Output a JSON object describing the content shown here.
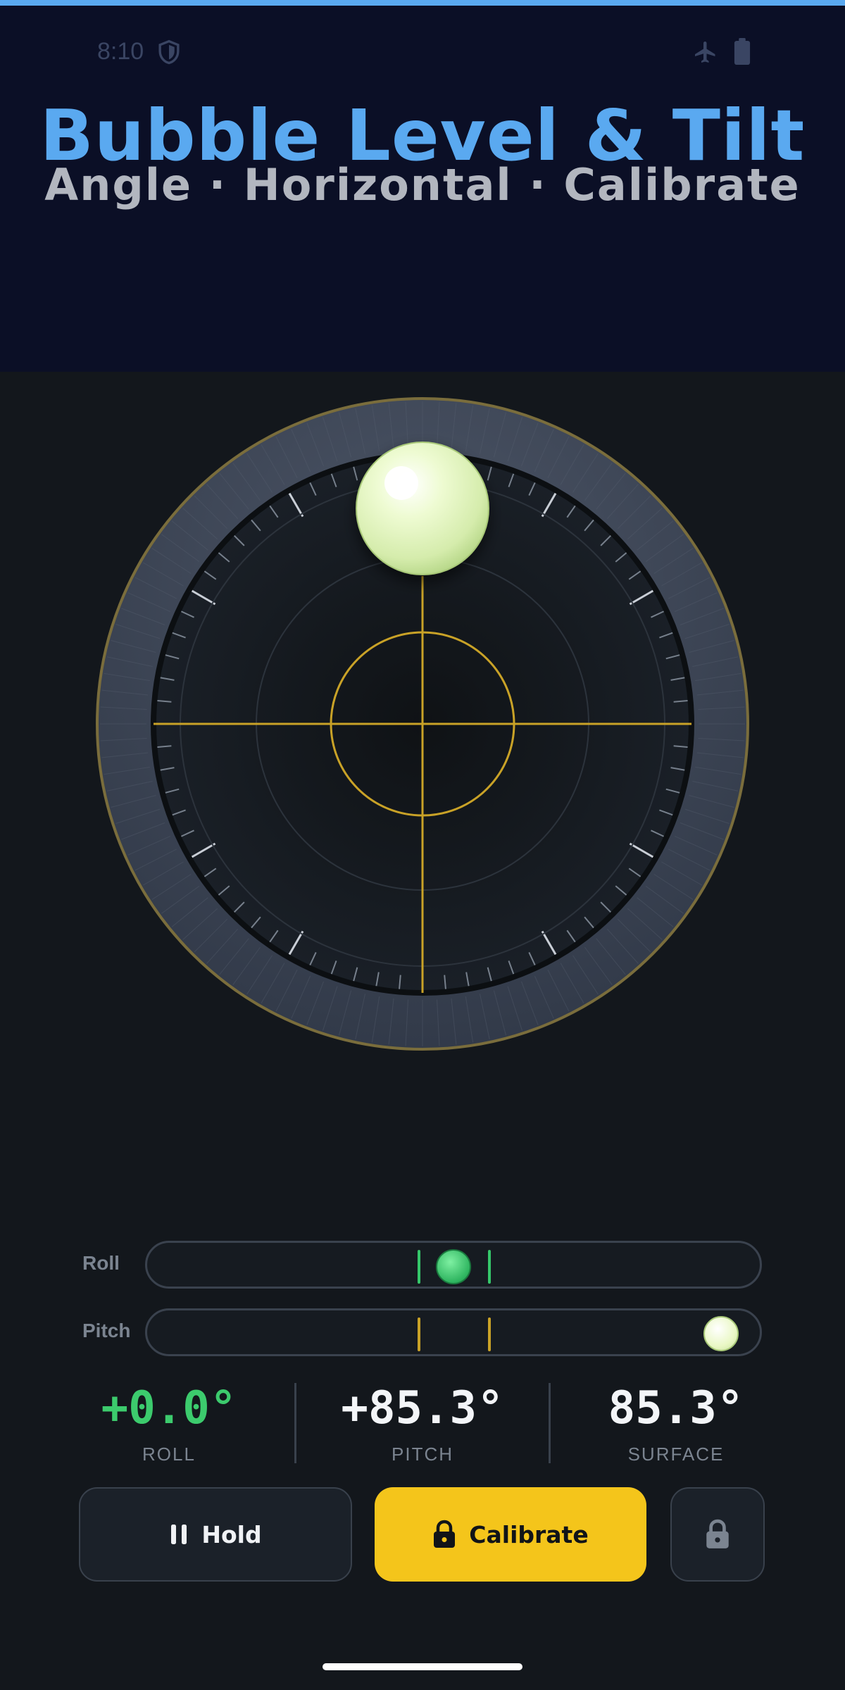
{
  "status_bar": {
    "time": "8:10"
  },
  "header": {
    "title": "Bubble Level & Tilt",
    "subtitle": "Angle · Horizontal · Calibrate"
  },
  "colors": {
    "accent_blue": "#5aa9f0",
    "gold": "#c9a227",
    "green": "#35c76a",
    "bubble": "#e9f7c8",
    "button_yellow": "#f4c51b"
  },
  "tracks": {
    "roll": {
      "label": "Roll",
      "position": 0.5,
      "color": "green"
    },
    "pitch": {
      "label": "Pitch",
      "position": 0.97,
      "color": "gold"
    }
  },
  "readouts": [
    {
      "value": "+0.0°",
      "label": "ROLL",
      "color": "#3ccb6d"
    },
    {
      "value": "+85.3°",
      "label": "PITCH",
      "color": "#f3f5f8"
    },
    {
      "value": "85.3°",
      "label": "SURFACE",
      "color": "#f3f5f8"
    }
  ],
  "buttons": {
    "hold_label": "Hold",
    "calibrate_label": "Calibrate",
    "hold_icon": "pause-icon",
    "calibrate_icon": "lock-icon",
    "lock_icon": "lock-icon"
  }
}
